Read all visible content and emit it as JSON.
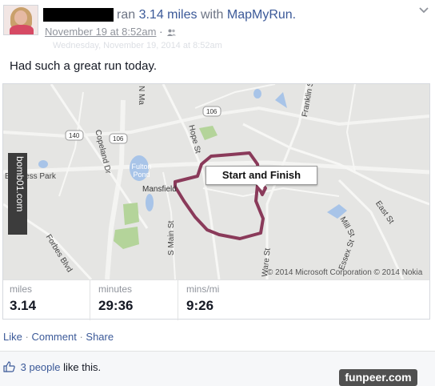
{
  "post": {
    "title_prefix": "ran",
    "distance_text": "3.14 miles",
    "title_with": "with",
    "app_name": "MapMyRun.",
    "timestamp": "November 19 at 8:52am",
    "timestamp_sep": "·",
    "timestamp_tooltip": "Wednesday, November 19, 2014 at 8:52am",
    "status": "Had such a great run today."
  },
  "map": {
    "callout": "Start and Finish",
    "copyright": "© 2014 Microsoft Corporation © 2014 Nokia",
    "labels": {
      "n_main": "N Ma",
      "franklin": "Franklin St",
      "route_106_a": "106",
      "route_106_b": "106",
      "route_140": "140",
      "copeland": "Copeland Dr",
      "hope": "Hope St",
      "business_park": "Business Park",
      "fulton_pond": "Fulton Pond",
      "mansfield": "Mansfield",
      "east_st": "East St",
      "mill_st": "Mill St",
      "essex_st": "Essex St",
      "s_main": "S Main St",
      "ware_st": "Ware St",
      "forbes": "Forbes Blvd"
    },
    "route_color": "#8a3a5a",
    "side_watermark": "bomb01.com"
  },
  "stats": [
    {
      "label": "miles",
      "value": "3.14"
    },
    {
      "label": "minutes",
      "value": "29:36"
    },
    {
      "label": "mins/mi",
      "value": "9:26"
    }
  ],
  "actions": {
    "like": "Like",
    "comment": "Comment",
    "share": "Share",
    "sep": "·"
  },
  "likes": {
    "count_text": "3 people",
    "suffix": "like this."
  },
  "watermark": "funpeer.com"
}
